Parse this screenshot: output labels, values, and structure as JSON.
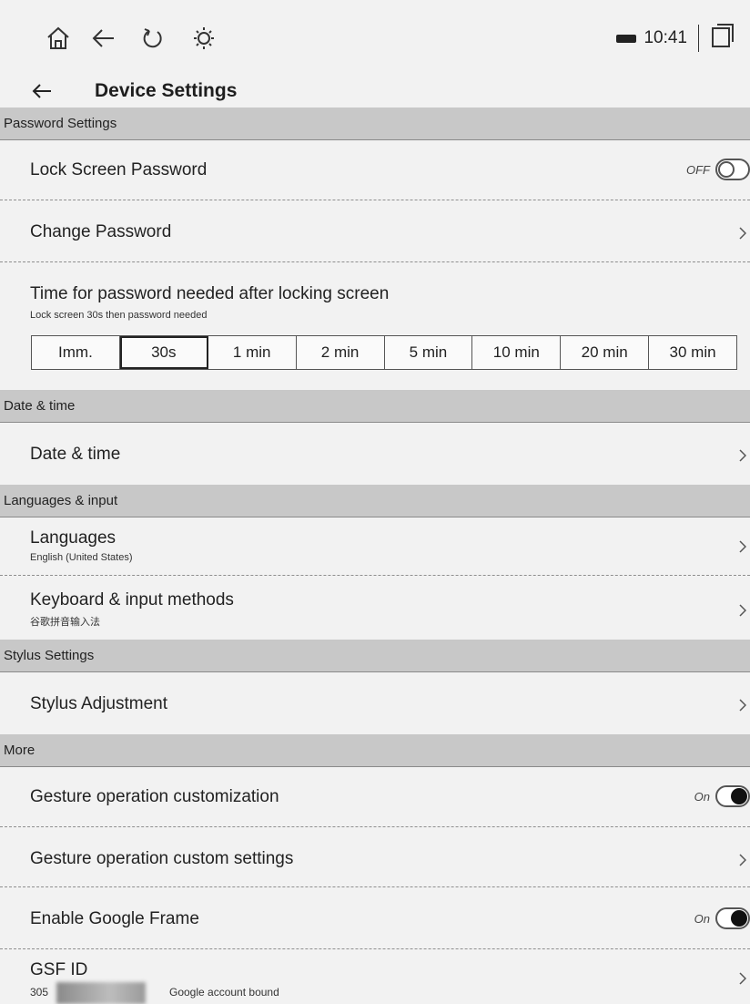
{
  "status_bar": {
    "icons": [
      "home-icon",
      "back-arrow-icon",
      "refresh-icon",
      "lightbulb-icon"
    ],
    "time": "10:41",
    "right_icon": "window-icon"
  },
  "header": {
    "title": "Device Settings"
  },
  "sections": {
    "password": {
      "header": "Password Settings",
      "lock_screen": {
        "label": "Lock Screen Password",
        "toggle_text": "OFF",
        "state": "off"
      },
      "change_password": {
        "label": "Change Password"
      },
      "time_needed": {
        "label": "Time for password needed after locking screen",
        "sub": "Lock screen 30s then password needed",
        "options": [
          "Imm.",
          "30s",
          "1 min",
          "2 min",
          "5 min",
          "10 min",
          "20 min",
          "30 min"
        ],
        "selected": "30s"
      }
    },
    "date_time": {
      "header": "Date & time",
      "item": {
        "label": "Date & time"
      }
    },
    "languages": {
      "header": "Languages & input",
      "languages": {
        "label": "Languages",
        "sub": "English (United States)"
      },
      "keyboard": {
        "label": "Keyboard & input methods",
        "sub": "谷歌拼音输入法"
      }
    },
    "stylus": {
      "header": "Stylus Settings",
      "adjustment": {
        "label": "Stylus Adjustment"
      }
    },
    "more": {
      "header": "More",
      "gesture_custom": {
        "label": "Gesture operation customization",
        "toggle_text": "On",
        "state": "on"
      },
      "gesture_settings": {
        "label": "Gesture operation custom settings"
      },
      "google_frame": {
        "label": "Enable Google Frame",
        "toggle_text": "On",
        "state": "on"
      },
      "gsf_id": {
        "label": "GSF ID",
        "value_prefix": "305",
        "status": "Google account bound"
      }
    }
  }
}
